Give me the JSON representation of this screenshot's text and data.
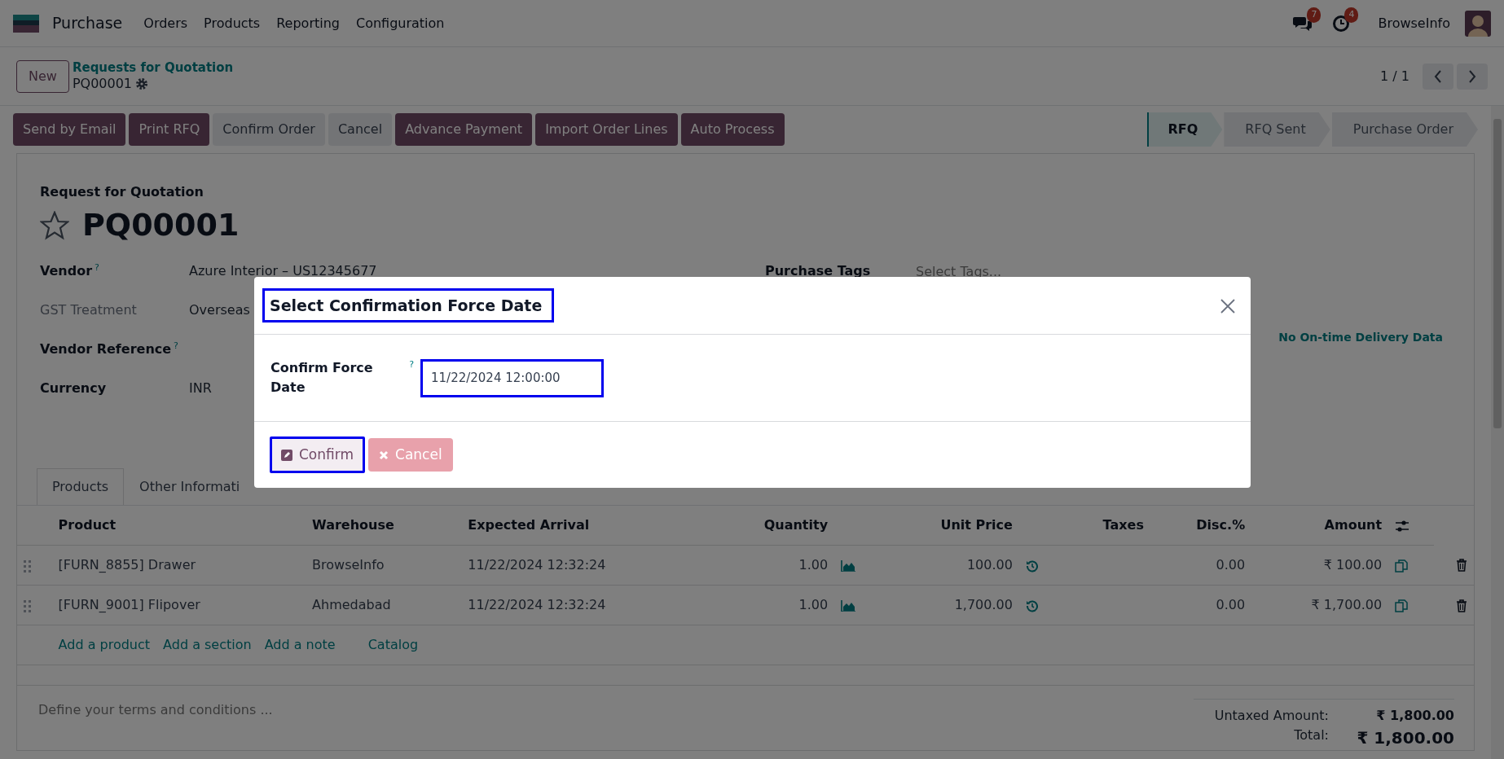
{
  "navbar": {
    "app": "Purchase",
    "menu": [
      "Orders",
      "Products",
      "Reporting",
      "Configuration"
    ],
    "chat_badge": "7",
    "activity_badge": "4",
    "company": "BrowseInfo"
  },
  "control_panel": {
    "new_button": "New",
    "breadcrumb": "Requests for Quotation",
    "record": "PQ00001",
    "pager": "1 / 1"
  },
  "actions": [
    {
      "label": "Send by Email",
      "kind": "primary"
    },
    {
      "label": "Print RFQ",
      "kind": "primary"
    },
    {
      "label": "Confirm Order",
      "kind": "secondary"
    },
    {
      "label": "Cancel",
      "kind": "secondary"
    },
    {
      "label": "Advance Payment",
      "kind": "primary"
    },
    {
      "label": "Import Order Lines",
      "kind": "primary"
    },
    {
      "label": "Auto Process",
      "kind": "primary"
    }
  ],
  "statusbar": [
    {
      "label": "RFQ",
      "selected": true
    },
    {
      "label": "RFQ Sent",
      "selected": false
    },
    {
      "label": "Purchase Order",
      "selected": false
    }
  ],
  "form": {
    "subtitle": "Request for Quotation",
    "name": "PQ00001",
    "starred": false,
    "left_fields": [
      {
        "label": "Vendor",
        "help": "?",
        "value": "Azure Interior – US12345677",
        "kind": "bold"
      },
      {
        "label": "GST Treatment",
        "value": "Overseas",
        "kind": "plain"
      },
      {
        "label": "Vendor Reference",
        "help": "?",
        "kind": "bold"
      },
      {
        "label": "Currency",
        "value": "INR",
        "kind": "bold"
      }
    ],
    "right_fields": [
      {
        "label": "Purchase Tags",
        "placeholder": "Select Tags..."
      }
    ],
    "on_time": "No On-time Delivery Data",
    "tabs": [
      {
        "label": "Products",
        "selected": true
      },
      {
        "label": "Other Informati",
        "selected": false
      }
    ]
  },
  "table": {
    "columns": [
      "Product",
      "Warehouse",
      "Expected Arrival",
      "Quantity",
      "Unit Price",
      "Taxes",
      "Disc.%",
      "Amount"
    ],
    "rows": [
      {
        "product": "[FURN_8855] Drawer",
        "warehouse": "BrowseInfo",
        "arrival": "11/22/2024 12:32:24",
        "quantity": "1.00",
        "unit_price": "100.00",
        "discount": "0.00",
        "amount": "₹ 100.00"
      },
      {
        "product": "[FURN_9001] Flipover",
        "warehouse": "Ahmedabad",
        "arrival": "11/22/2024 12:32:24",
        "quantity": "1.00",
        "unit_price": "1,700.00",
        "discount": "0.00",
        "amount": "₹ 1,700.00"
      }
    ],
    "add_links": [
      "Add a product",
      "Add a section",
      "Add a note",
      "Catalog"
    ],
    "terms_placeholder": "Define your terms and conditions ...",
    "totals": [
      {
        "label": "Untaxed Amount:",
        "value": "₹ 1,800.00"
      },
      {
        "label": "Total:",
        "value": "₹ 1,800.00"
      }
    ]
  },
  "modal": {
    "title": "Select Confirmation Force Date",
    "field_label": "Confirm Force Date",
    "help": "?",
    "value": "11/22/2024 12:00:00",
    "confirm": "Confirm",
    "cancel": "Cancel"
  }
}
